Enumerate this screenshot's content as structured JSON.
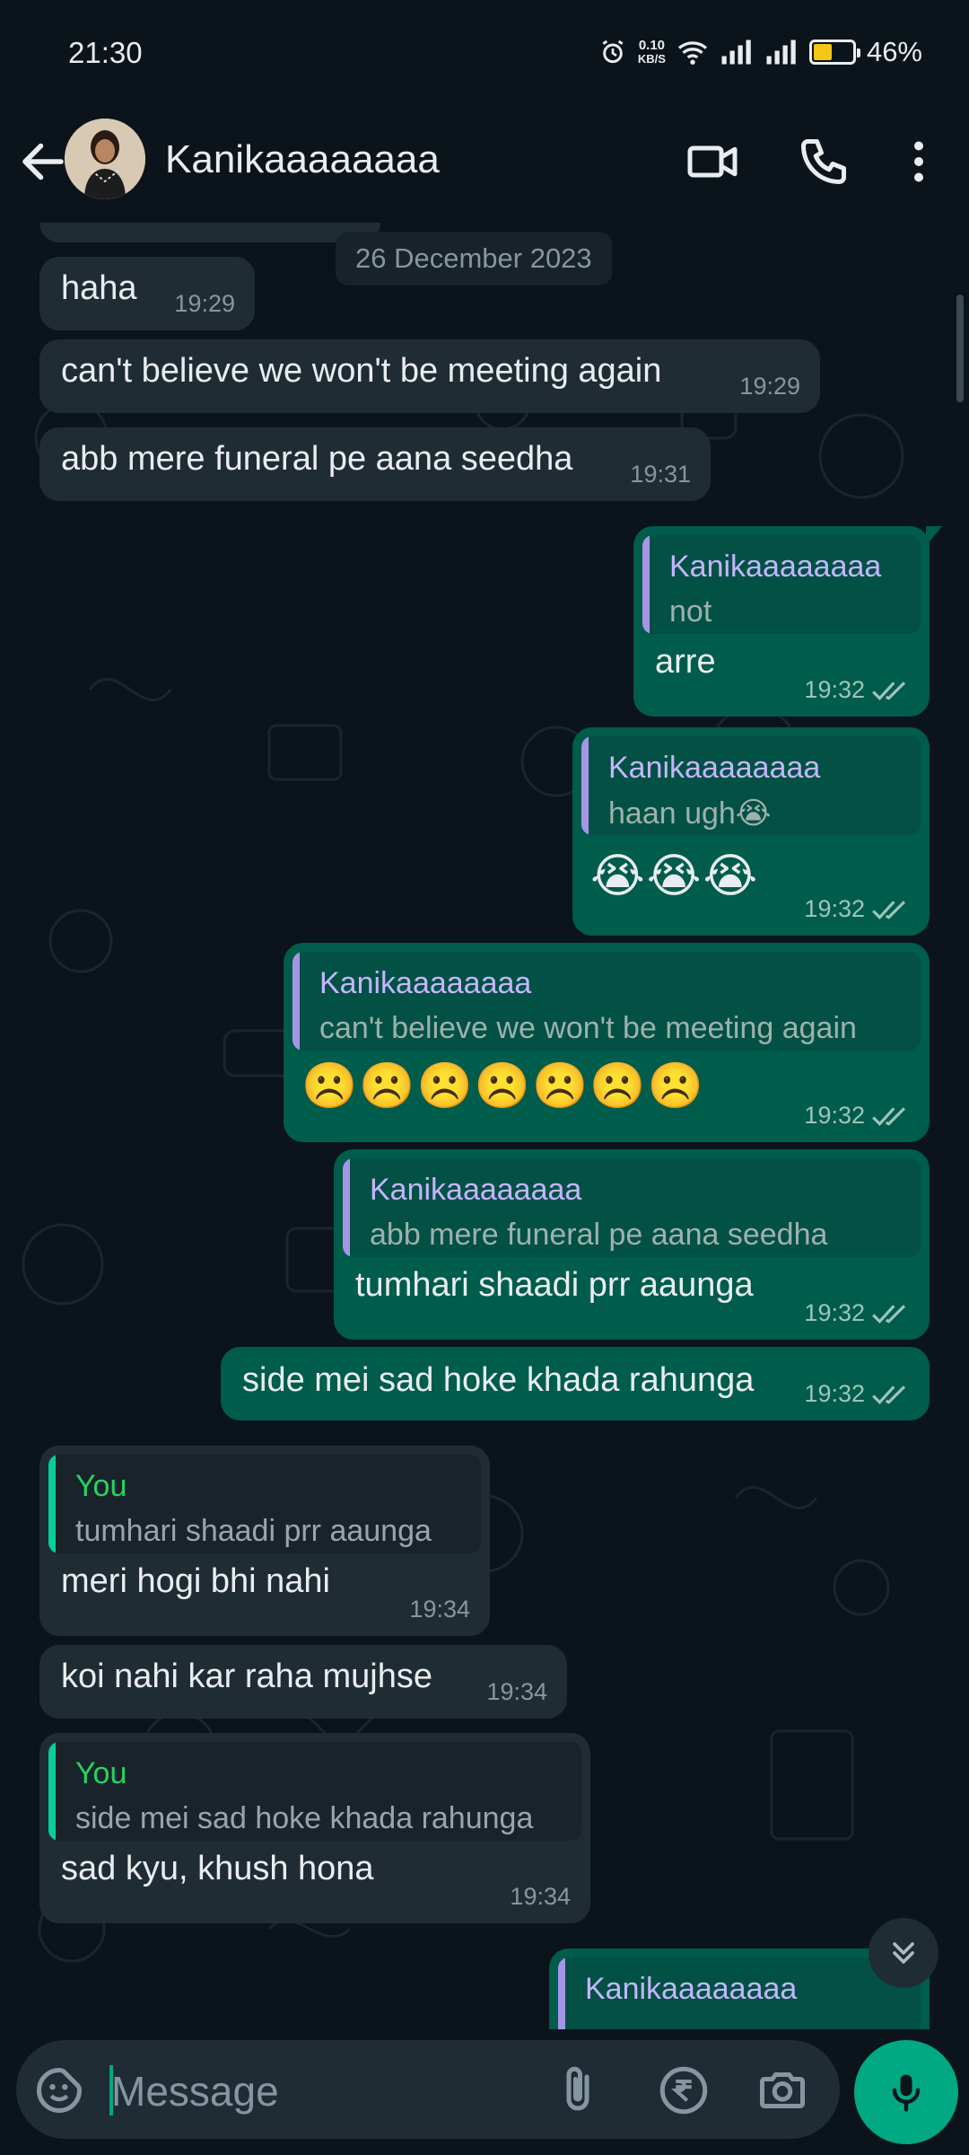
{
  "status_bar": {
    "time": "21:30",
    "net_speed_value": "0.10",
    "net_speed_unit": "KB/S",
    "battery": "46%",
    "icons": [
      "alarm-icon",
      "wifi-icon",
      "signal-icon",
      "signal-icon",
      "battery-icon"
    ]
  },
  "header": {
    "contact_name": "Kanikaaaaaaaa",
    "icons": [
      "back-arrow-icon",
      "video-call-icon",
      "phone-icon",
      "more-vertical-icon"
    ]
  },
  "chat": {
    "date_chip": "26 December 2023",
    "messages": [
      {
        "dir": "in",
        "text": "haha",
        "time": "19:29"
      },
      {
        "dir": "in",
        "text": "can't believe we won't be meeting again",
        "time": "19:29"
      },
      {
        "dir": "in",
        "text": "abb mere funeral pe aana seedha",
        "time": "19:31"
      },
      {
        "dir": "out",
        "reply_name": "Kanikaaaaaaaa",
        "reply_text": "not",
        "text": "arre",
        "time": "19:32"
      },
      {
        "dir": "out",
        "reply_name": "Kanikaaaaaaaa",
        "reply_text": "haan ugh😭",
        "text": "😭😭😭",
        "time": "19:32"
      },
      {
        "dir": "out",
        "reply_name": "Kanikaaaaaaaa",
        "reply_text": "can't believe we won't be meeting again",
        "text": "☹️☹️☹️☹️☹️☹️☹️",
        "time": "19:32"
      },
      {
        "dir": "out",
        "reply_name": "Kanikaaaaaaaa",
        "reply_text": "abb mere funeral pe aana seedha",
        "text": "tumhari shaadi prr aaunga",
        "time": "19:32"
      },
      {
        "dir": "out",
        "text": "side mei sad hoke khada rahunga",
        "time": "19:32"
      },
      {
        "dir": "in",
        "reply_name": "You",
        "reply_text": "tumhari shaadi prr aaunga",
        "text": "meri hogi bhi nahi",
        "time": "19:34"
      },
      {
        "dir": "in",
        "text": "koi nahi kar raha mujhse",
        "time": "19:34"
      },
      {
        "dir": "in",
        "reply_name": "You",
        "reply_text": "side mei sad hoke khada rahunga",
        "text": "sad kyu, khush hona",
        "time": "19:34"
      },
      {
        "dir": "out",
        "reply_name": "Kanikaaaaaaaa"
      }
    ]
  },
  "input": {
    "placeholder": "Message",
    "icons": [
      "sticker-icon",
      "attach-icon",
      "rupee-payment-icon",
      "camera-icon",
      "mic-icon"
    ]
  },
  "colors": {
    "background": "#0b141a",
    "incoming_bubble": "#202c33",
    "outgoing_bubble": "#005c4b",
    "accent": "#00a884",
    "reply_name_purple": "#c4b5fd",
    "reply_name_green": "#25d366"
  }
}
